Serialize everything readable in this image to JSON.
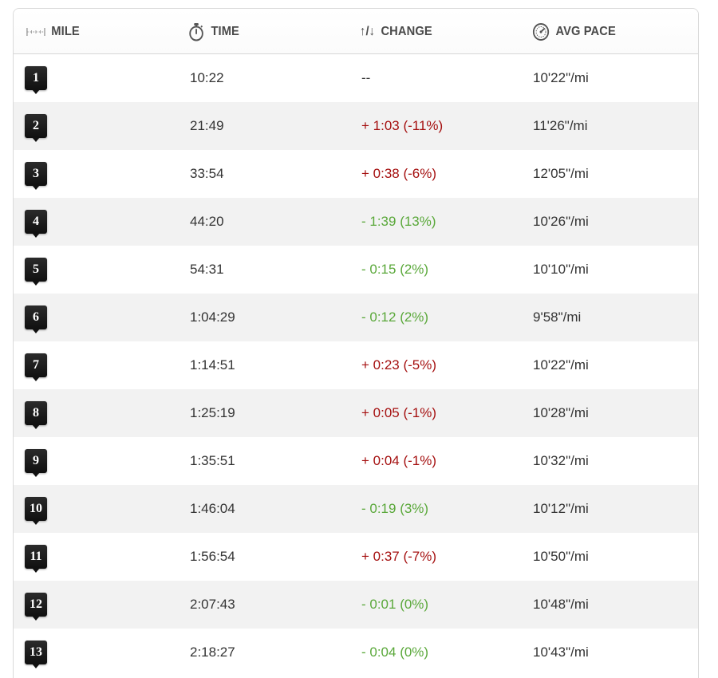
{
  "header": {
    "mile_label": "MILE",
    "time_label": "TIME",
    "change_label": "CHANGE",
    "change_icon_text": "↑/↓",
    "pace_label": "AVG PACE",
    "icons": {
      "mile": "ruler-icon",
      "time": "stopwatch-icon",
      "change": "up-down-arrows-icon",
      "pace": "speedometer-icon"
    }
  },
  "colors": {
    "slower": "#a51010",
    "faster": "#5aa83a",
    "marker": "#111111",
    "alt_row": "#f2f2f2"
  },
  "splits": [
    {
      "mile": "1",
      "time": "10:22",
      "change": "--",
      "trend": "none",
      "pace": "10'22\"/mi"
    },
    {
      "mile": "2",
      "time": "21:49",
      "change": "+ 1:03 (-11%)",
      "trend": "slower",
      "pace": "11'26\"/mi"
    },
    {
      "mile": "3",
      "time": "33:54",
      "change": "+ 0:38 (-6%)",
      "trend": "slower",
      "pace": "12'05\"/mi"
    },
    {
      "mile": "4",
      "time": "44:20",
      "change": "- 1:39 (13%)",
      "trend": "faster",
      "pace": "10'26\"/mi"
    },
    {
      "mile": "5",
      "time": "54:31",
      "change": "- 0:15 (2%)",
      "trend": "faster",
      "pace": "10'10\"/mi"
    },
    {
      "mile": "6",
      "time": "1:04:29",
      "change": "- 0:12 (2%)",
      "trend": "faster",
      "pace": "9'58\"/mi"
    },
    {
      "mile": "7",
      "time": "1:14:51",
      "change": "+ 0:23 (-5%)",
      "trend": "slower",
      "pace": "10'22\"/mi"
    },
    {
      "mile": "8",
      "time": "1:25:19",
      "change": "+ 0:05 (-1%)",
      "trend": "slower",
      "pace": "10'28\"/mi"
    },
    {
      "mile": "9",
      "time": "1:35:51",
      "change": "+ 0:04 (-1%)",
      "trend": "slower",
      "pace": "10'32\"/mi"
    },
    {
      "mile": "10",
      "time": "1:46:04",
      "change": "- 0:19 (3%)",
      "trend": "faster",
      "pace": "10'12\"/mi"
    },
    {
      "mile": "11",
      "time": "1:56:54",
      "change": "+ 0:37 (-7%)",
      "trend": "slower",
      "pace": "10'50\"/mi"
    },
    {
      "mile": "12",
      "time": "2:07:43",
      "change": "- 0:01 (0%)",
      "trend": "faster",
      "pace": "10'48\"/mi"
    },
    {
      "mile": "13",
      "time": "2:18:27",
      "change": "- 0:04 (0%)",
      "trend": "faster",
      "pace": "10'43\"/mi"
    }
  ]
}
